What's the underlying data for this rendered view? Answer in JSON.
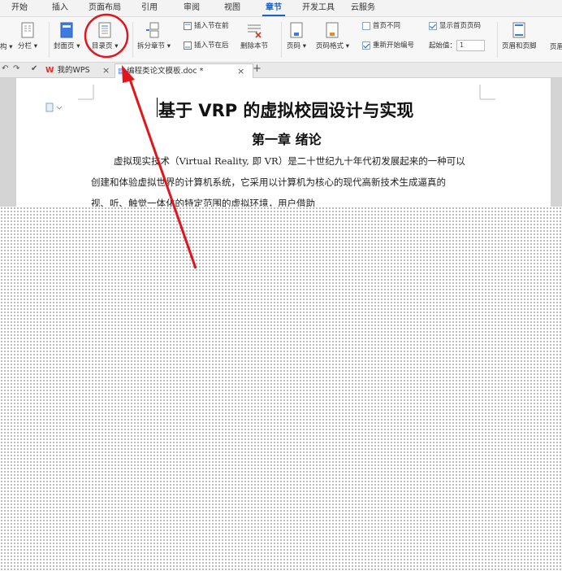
{
  "menu": {
    "items": [
      "开始",
      "插入",
      "页面布局",
      "引用",
      "审阅",
      "视图",
      "章节",
      "开发工具",
      "云服务"
    ],
    "active": "章节"
  },
  "ribbon": {
    "left_partial_1": "构 ▾",
    "left_partial_2": "分栏 ▾",
    "cover_page": "封面页 ▾",
    "toc_page": "目录页 ▾",
    "split_chapter": "拆分章节 ▾",
    "insert_section_before": "插入节在前",
    "insert_section_after": "插入节在后",
    "delete_section": "删除本节",
    "page_number": "页码 ▾",
    "page_number_format": "页码格式 ▾",
    "first_page_different": "首页不同",
    "show_first_page_number": "显示首页页码",
    "restart_numbering": "重新开始编号",
    "start_value_label": "起始值：",
    "start_value": "1",
    "header_footer": "页眉和页脚",
    "header_partial": "页眉"
  },
  "tabs": {
    "wps_tab": "我的WPS",
    "doc_tab": "编程类论文模板.doc *",
    "add": "+",
    "close": "×"
  },
  "document": {
    "title": "基于 VRP 的虚拟校园设计与实现",
    "chapter": "第一章  绪论",
    "para_line1": "虚拟现实技术（Virtual Reality, 即 VR）是二十世纪九十年代初发展起来的一种可以",
    "para_line2": "创建和体验虚拟世界的计算机系统，它采用以计算机为核心的现代高新技术生成逼真的",
    "para_line3": "视、听、触觉一体化的特定范围的虚拟环境，用户借助"
  },
  "colors": {
    "accent": "#1a63c6",
    "annotation": "#e0161c",
    "wps_red": "#d9322b"
  }
}
